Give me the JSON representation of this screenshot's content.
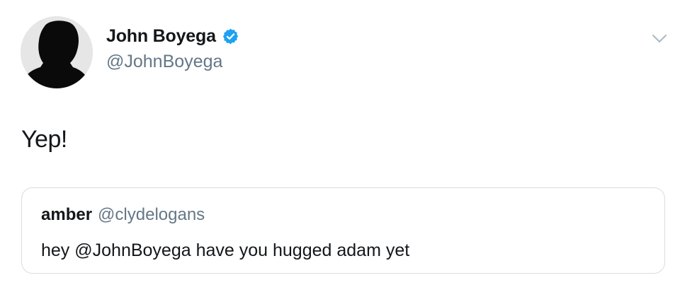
{
  "author": {
    "display_name": "John Boyega",
    "handle": "@JohnBoyega",
    "verified_icon": "verified-badge-icon",
    "verified_color": "#1da1f2"
  },
  "tweet": {
    "text": "Yep!"
  },
  "menu": {
    "icon": "chevron-down-icon"
  },
  "quoted_tweet": {
    "display_name": "amber",
    "handle": "@clydelogans",
    "text": "hey @JohnBoyega have you hugged adam yet"
  },
  "colors": {
    "text": "#14171a",
    "secondary_text": "#657786",
    "border": "#d8dde2"
  }
}
